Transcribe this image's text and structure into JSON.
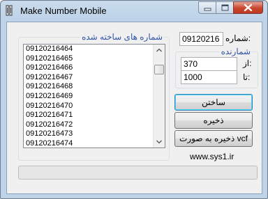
{
  "window": {
    "title": "Make Number Mobile"
  },
  "list_group": {
    "legend": "شماره های ساخته شده",
    "items": [
      "09120216464",
      "09120216465",
      "09120216466",
      "09120216467",
      "09120216468",
      "09120216469",
      "09120216470",
      "09120216471",
      "09120216472",
      "09120216473",
      "09120216474"
    ]
  },
  "number_field": {
    "label": "شماره:",
    "value": "09120216"
  },
  "counter_group": {
    "legend": "شمارنده",
    "from_label": "از:",
    "from_value": "370",
    "to_label": "تا:",
    "to_value": "1000"
  },
  "buttons": {
    "build": "ساختن",
    "save": "ذخیره",
    "save_vcf": "ذخیره به صورت vcf"
  },
  "website": "www.sys1.ir",
  "progress": {
    "fraction": 0
  },
  "icons": {
    "app": "app-icon",
    "minimize": "minimize-icon",
    "maximize": "maximize-icon",
    "close": "close-icon"
  }
}
